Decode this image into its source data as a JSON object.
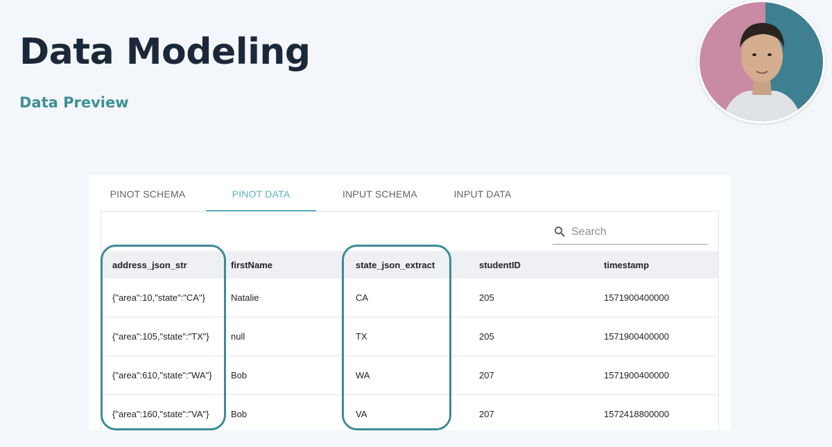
{
  "slide": {
    "title": "Data Modeling",
    "subtitle": "Data Preview"
  },
  "tabs": [
    {
      "label": "PINOT SCHEMA",
      "active": false
    },
    {
      "label": "PINOT DATA",
      "active": true
    },
    {
      "label": "INPUT SCHEMA",
      "active": false
    },
    {
      "label": "INPUT DATA",
      "active": false
    }
  ],
  "search": {
    "placeholder": "Search",
    "value": ""
  },
  "table": {
    "columns": [
      "address_json_str",
      "firstName",
      "state_json_extract",
      "studentID",
      "timestamp"
    ],
    "rows": [
      [
        "{\"area\":10,\"state\":\"CA\"}",
        "Natalie",
        "CA",
        "205",
        "1571900400000"
      ],
      [
        "{\"area\":105,\"state\":\"TX\"}",
        "null",
        "TX",
        "205",
        "1571900400000"
      ],
      [
        "{\"area\":610,\"state\":\"WA\"}",
        "Bob",
        "WA",
        "207",
        "1571900400000"
      ],
      [
        "{\"area\":160,\"state\":\"VA\"}",
        "Bob",
        "VA",
        "207",
        "1572418800000"
      ]
    ]
  },
  "colors": {
    "accent": "#5ab3bd",
    "highlight": "#3b8b96",
    "title": "#1b2838",
    "subtitle": "#3e8f96"
  },
  "icons": {
    "search": "search-icon"
  }
}
